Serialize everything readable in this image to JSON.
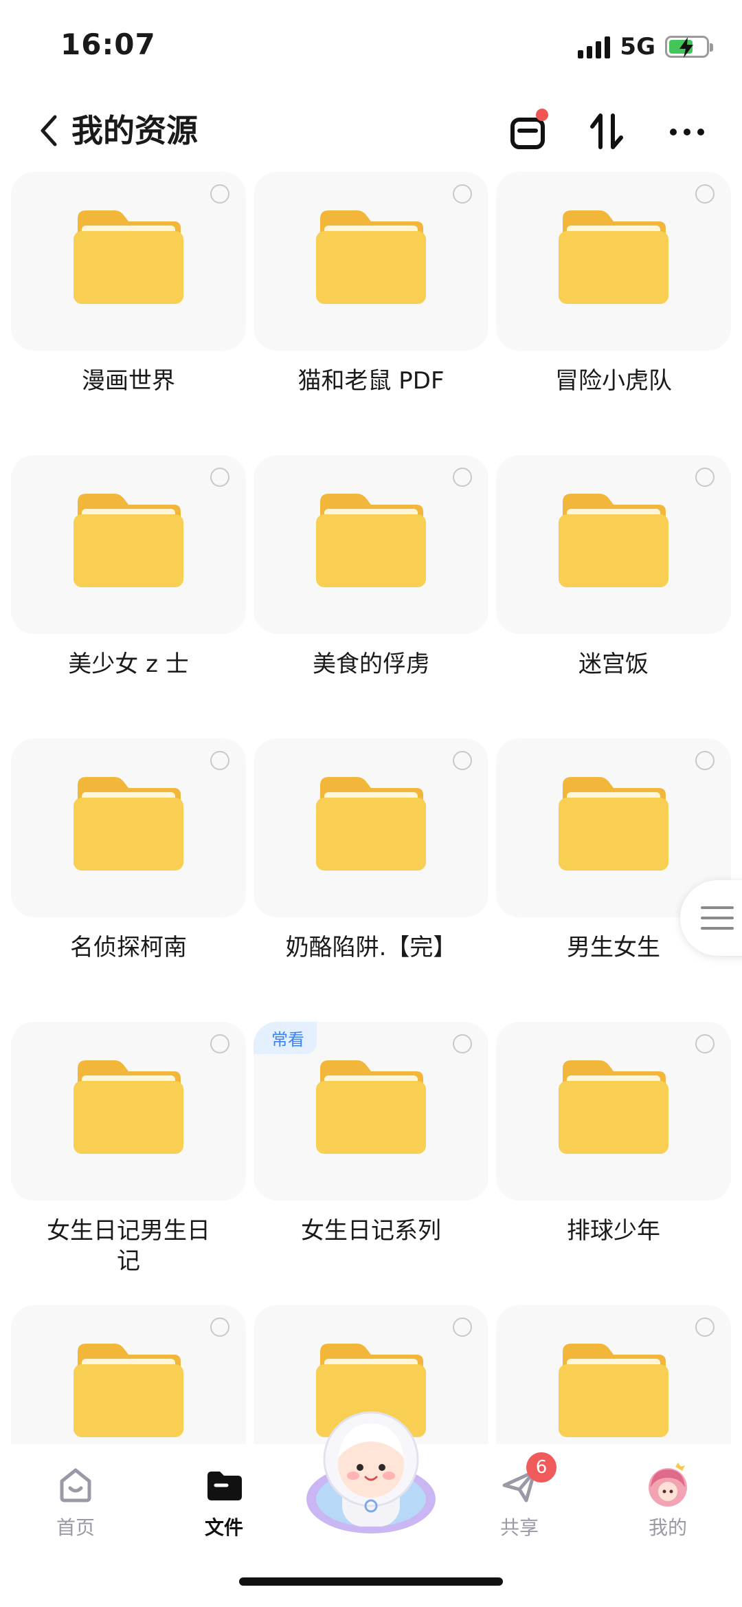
{
  "status": {
    "time": "16:07",
    "network": "5G"
  },
  "header": {
    "title": "我的资源"
  },
  "folders": [
    {
      "label": "漫画世界"
    },
    {
      "label": "猫和老鼠 PDF"
    },
    {
      "label": "冒险小虎队"
    },
    {
      "label": "美少女 z 士"
    },
    {
      "label": "美食的俘虏"
    },
    {
      "label": "迷宫饭"
    },
    {
      "label": "名侦探柯南"
    },
    {
      "label": "奶酪陷阱.【完】"
    },
    {
      "label": "男生女生"
    },
    {
      "label": "女生日记男生日记"
    },
    {
      "label": "女生日记系列",
      "badge": "常看"
    },
    {
      "label": "排球少年"
    },
    {
      "label": ""
    },
    {
      "label": ""
    },
    {
      "label": ""
    }
  ],
  "tabs": [
    {
      "label": "首页",
      "icon": "home-icon"
    },
    {
      "label": "文件",
      "icon": "file-icon"
    },
    {
      "label": "共享",
      "icon": "share-icon",
      "badge": "6"
    },
    {
      "label": "我的",
      "icon": "avatar-icon"
    }
  ],
  "colors": {
    "folder": "#f8cf52",
    "badge": "#f05a5a",
    "accent": "#3b82f6"
  }
}
